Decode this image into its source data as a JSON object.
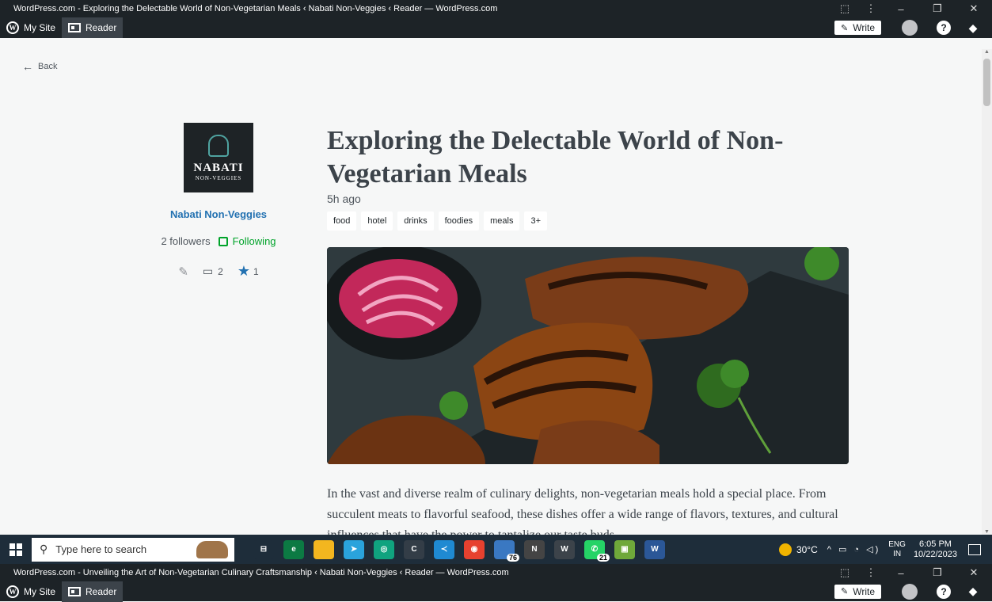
{
  "window1": {
    "title": "WordPress.com - Exploring the Delectable World of Non-Vegetarian Meals ‹ Nabati Non-Veggies ‹ Reader — WordPress.com",
    "controls": [
      "⬚",
      "⋮",
      "–",
      "❐",
      "✕"
    ]
  },
  "adminbar": {
    "my_site": "My Site",
    "reader": "Reader",
    "write": "Write",
    "help": "?"
  },
  "reader": {
    "back": "Back",
    "site": {
      "logo_title": "NABATI",
      "logo_subtitle": "NON-VEGGIES",
      "name": "Nabati Non-Veggies",
      "followers": "2 followers",
      "following": "Following",
      "comments": "2",
      "likes": "1"
    },
    "post": {
      "title": "Exploring the Delectable World of Non-Vegetarian Meals",
      "time": "5h ago",
      "tags": [
        "food",
        "hotel",
        "drinks",
        "foodies",
        "meals",
        "3+"
      ],
      "excerpt": "In the vast and diverse realm of culinary delights, non-vegetarian meals hold a special place. From succulent meats to flavorful seafood, these dishes offer a wide range of flavors, textures, and cultural influences that have the power to tantalize our taste buds."
    }
  },
  "taskbar": {
    "search_placeholder": "Type here to search",
    "apps": [
      {
        "name": "task-view",
        "color": "#1e2d3a",
        "label": "⊟"
      },
      {
        "name": "edge",
        "color": "#0c7a43",
        "label": "e"
      },
      {
        "name": "file-explorer",
        "color": "#f3b61f",
        "label": ""
      },
      {
        "name": "telegram",
        "color": "#2aa3dc",
        "label": "➤"
      },
      {
        "name": "chatgpt",
        "color": "#10a37f",
        "label": "◎"
      },
      {
        "name": "app-c",
        "color": "#333d47",
        "label": "C"
      },
      {
        "name": "vscode",
        "color": "#1f8ad2",
        "label": "≺"
      },
      {
        "name": "chrome",
        "color": "#e7412f",
        "label": "◉"
      },
      {
        "name": "app-76",
        "color": "#3a78c2",
        "label": "",
        "badge": "76"
      },
      {
        "name": "notion",
        "color": "#444",
        "label": "N"
      },
      {
        "name": "wordpress",
        "color": "#3c434a",
        "label": "W"
      },
      {
        "name": "whatsapp",
        "color": "#25d366",
        "label": "✆",
        "badge": "21"
      },
      {
        "name": "photos",
        "color": "#6fa83a",
        "label": "▣"
      },
      {
        "name": "word",
        "color": "#2b5797",
        "label": "W"
      }
    ],
    "weather": "30°C",
    "tray_icons": "^ ▭ ◔ ◁)",
    "lang_1": "ENG",
    "lang_2": "IN",
    "time": "6:05 PM",
    "date": "10/22/2023"
  },
  "window2": {
    "title": "WordPress.com - Unveiling the Art of Non-Vegetarian Culinary Craftsmanship ‹ Nabati Non-Veggies ‹ Reader — WordPress.com",
    "controls": [
      "⬚",
      "⋮",
      "–",
      "❐",
      "✕"
    ]
  }
}
